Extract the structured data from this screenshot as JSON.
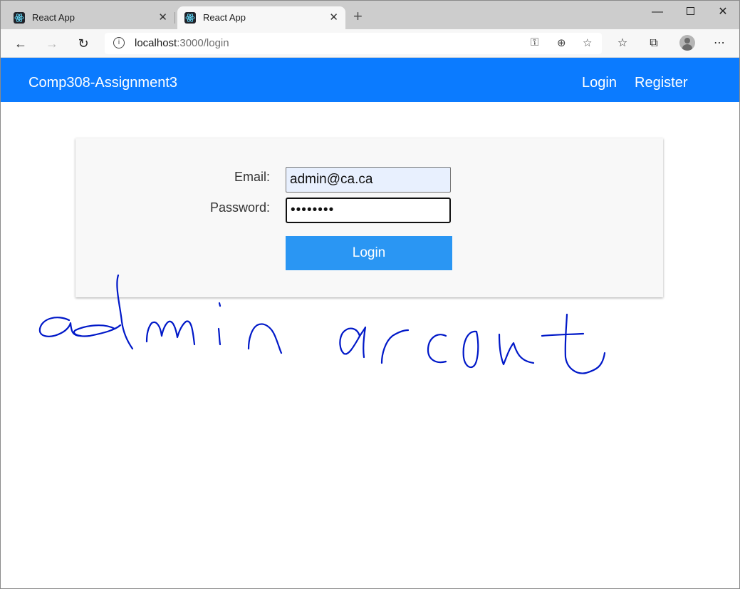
{
  "browser": {
    "tabs": [
      {
        "title": "React App",
        "close": "✕"
      },
      {
        "title": "React App",
        "close": "✕"
      }
    ],
    "new_tab": "+",
    "address": {
      "host": "localhost",
      "path": ":3000/login"
    }
  },
  "navbar": {
    "brand": "Comp308-Assignment3",
    "links": [
      "Login",
      "Register"
    ]
  },
  "form": {
    "email_label": "Email:",
    "email_value": "admin@ca.ca",
    "password_label": "Password:",
    "password_value": "••••••••",
    "submit_label": "Login"
  },
  "annotation": {
    "handwritten_text": "admin arcount",
    "color": "#0018c8"
  },
  "colors": {
    "navbar": "#0b7bff",
    "button": "#2a96f3",
    "autofill": "#e8f0fe"
  }
}
